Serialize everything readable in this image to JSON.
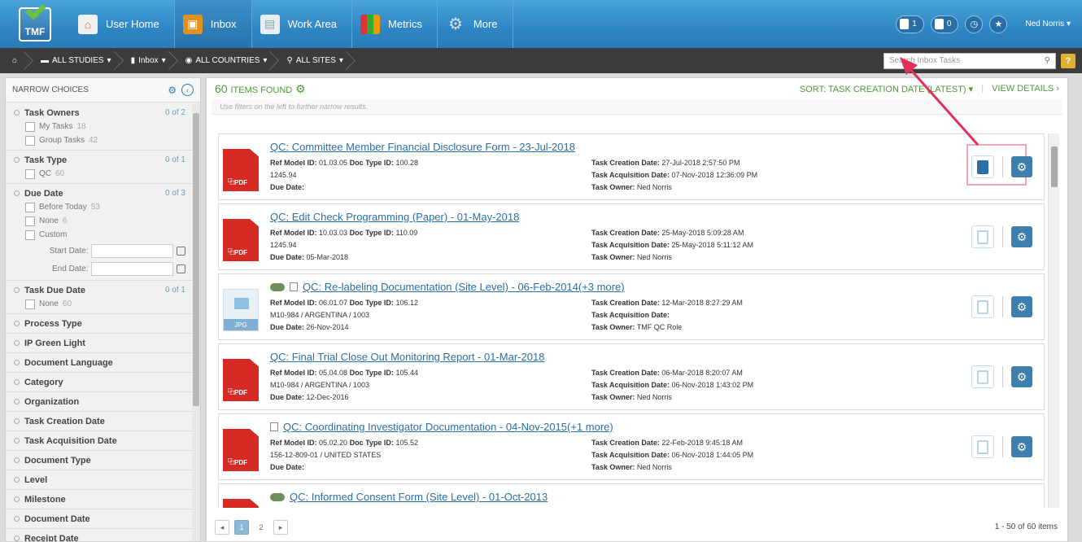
{
  "app": {
    "logo_text": "TMF"
  },
  "nav": {
    "tabs": [
      {
        "label": "User Home"
      },
      {
        "label": "Inbox"
      },
      {
        "label": "Work Area"
      },
      {
        "label": "Metrics"
      },
      {
        "label": "More"
      }
    ],
    "task_badge_1": "1",
    "task_badge_2": "0",
    "user_name": "Ned Norris"
  },
  "breadcrumb": {
    "items": [
      "ALL STUDIES",
      "Inbox",
      "ALL COUNTRIES",
      "ALL SITES"
    ],
    "search_placeholder": "Search Inbox Tasks"
  },
  "left": {
    "header": "NARROW CHOICES",
    "sections": [
      {
        "title": "Task Owners",
        "count": "0 of 2",
        "options": [
          {
            "label": "My Tasks",
            "n": "18"
          },
          {
            "label": "Group Tasks",
            "n": "42"
          }
        ]
      },
      {
        "title": "Task Type",
        "count": "0 of 1",
        "options": [
          {
            "label": "QC",
            "n": "60"
          }
        ]
      },
      {
        "title": "Due Date",
        "count": "0 of 3",
        "options": [
          {
            "label": "Before Today",
            "n": "53"
          },
          {
            "label": "None",
            "n": "6"
          },
          {
            "label": "Custom",
            "n": ""
          }
        ],
        "start_label": "Start Date:",
        "end_label": "End Date:"
      },
      {
        "title": "Task Due Date",
        "count": "0 of 1",
        "options": [
          {
            "label": "None",
            "n": "60"
          }
        ]
      }
    ],
    "collapsed": [
      "Process Type",
      "IP Green Light",
      "Document Language",
      "Category",
      "Organization",
      "Task Creation Date",
      "Task Acquisition Date",
      "Document Type",
      "Level",
      "Milestone",
      "Document Date",
      "Receipt Date"
    ]
  },
  "main": {
    "found_count": "60",
    "found_label": "ITEMS FOUND",
    "sort_label": "SORT: TASK CREATION DATE (LATEST)",
    "view_details": "VIEW DETAILS",
    "hint": "Use filters on the left to further narrow results.",
    "items": [
      {
        "title": "QC: Committee Member Financial Disclosure Form - 23-Jul-2018",
        "ref": "01.03.05",
        "doctype": "100.28",
        "sub": "1245.94",
        "due": "",
        "created": "27-Jul-2018 2:57:50 PM",
        "acquired": "07-Nov-2018 12:36:09 PM",
        "owner": "Ned Norris"
      },
      {
        "title": "QC: Edit Check Programming (Paper) - 01-May-2018",
        "ref": "10.03.03",
        "doctype": "110.09",
        "sub": "1245.94",
        "due": "05-Mar-2018",
        "created": "25-May-2018 5:09:28 AM",
        "acquired": "25-May-2018 5:11:12 AM",
        "owner": "Ned Norris"
      },
      {
        "title": "QC: Re-labeling Documentation (Site Level) - 06-Feb-2014(+3 more)",
        "ref": "06.01.07",
        "doctype": "106.12",
        "sub": "M10-984 / ARGENTINA / 1003",
        "due": "26-Nov-2014",
        "created": "12-Mar-2018 8:27:29 AM",
        "acquired": "",
        "owner": "TMF QC Role"
      },
      {
        "title": "QC: Final Trial Close Out Monitoring Report - 01-Mar-2018",
        "ref": "05.04.08",
        "doctype": "105.44",
        "sub": "M10-984 / ARGENTINA / 1003",
        "due": "12-Dec-2016",
        "created": "06-Mar-2018 8:20:07 AM",
        "acquired": "06-Nov-2018 1:43:02 PM",
        "owner": "Ned Norris"
      },
      {
        "title": "QC: Coordinating Investigator Documentation - 04-Nov-2015(+1 more)",
        "ref": "05.02.20",
        "doctype": "105.52",
        "sub": "156-12-809-01 / UNITED STATES",
        "due": "",
        "created": "22-Feb-2018 9:45:18 AM",
        "acquired": "06-Nov-2018 1:44:05 PM",
        "owner": "Ned Norris"
      },
      {
        "title": "QC: Informed Consent Form (Site Level) - 01-Oct-2013"
      }
    ],
    "labels": {
      "ref": "Ref Model ID:",
      "doctype": "Doc Type ID:",
      "due": "Due Date:",
      "created": "Task Creation Date:",
      "acquired": "Task Acquisition Date:",
      "owner": "Task Owner:"
    },
    "file_types": {
      "pdf": "PDF",
      "jpg": "JPG"
    },
    "pages": [
      "1",
      "2"
    ],
    "page_info": "1 - 50 of 60 items"
  },
  "colors": {
    "nav_blue": "#2f86c4",
    "green": "#4a9a3a",
    "link": "#2a6fa8",
    "highlight": "#f2a7b8",
    "arrow": "#e0305a"
  }
}
